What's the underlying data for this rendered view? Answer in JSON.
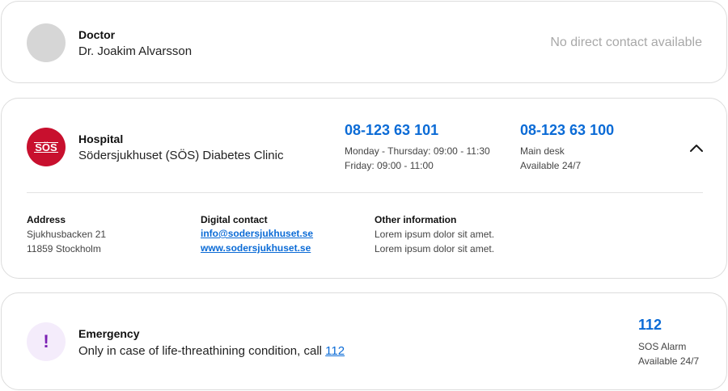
{
  "doctor": {
    "title": "Doctor",
    "name": "Dr. Joakim Alvarsson",
    "contact_status": "No direct contact available",
    "avatar_icon": "avatar-placeholder"
  },
  "hospital": {
    "title": "Hospital",
    "name": "Södersjukhuset (SÖS) Diabetes Clinic",
    "logo_text": "SÖS",
    "logo_color": "#c8102e",
    "phone_primary": {
      "number": "08-123 63 101",
      "line1": "Monday - Thursday: 09:00 - 11:30",
      "line2": "Friday: 09:00 - 11:00"
    },
    "phone_secondary": {
      "number": "08-123 63 100",
      "line1": "Main desk",
      "line2": "Available 24/7"
    },
    "collapse_icon": "chevron-up-icon",
    "address": {
      "label": "Address",
      "line1": "Sjukhusbacken 21",
      "line2": "11859 Stockholm"
    },
    "digital": {
      "label": "Digital contact",
      "email": "info@sodersjukhuset.se",
      "website": "www.sodersjukhuset.se"
    },
    "other": {
      "label": "Other information",
      "line1": "Lorem ipsum dolor sit amet.",
      "line2": "Lorem ipsum dolor sit amet."
    }
  },
  "emergency": {
    "title": "Emergency",
    "text_prefix": "Only in case of life-threathining condition, call",
    "text_link": "112",
    "icon": "exclamation-icon",
    "phone": {
      "number": "112",
      "line1": "SOS Alarm",
      "line2": "Available 24/7"
    }
  },
  "colors": {
    "accent": "#0b6bd6",
    "hospital_red": "#c8102e",
    "emergency_purple": "#7a1fb3",
    "border": "#dcdcdc"
  }
}
